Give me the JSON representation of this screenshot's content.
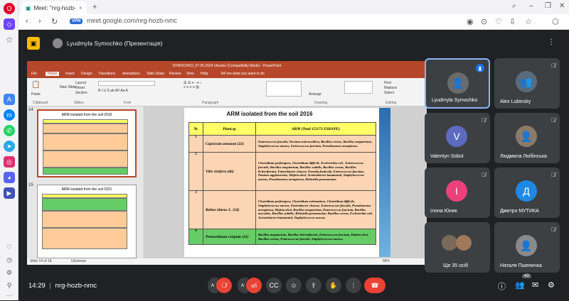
{
  "browser": {
    "tab_title": "Meet: \"nrg-hozb-",
    "url": "meet.google.com/nrg-hozb-nmc",
    "vpn_label": "VPN"
  },
  "presenter": {
    "label": "Lyudmyla Symochko (Презентація)"
  },
  "ppt": {
    "title": "SYMOCHKO_07.05.2024 Ukraine (Compatibility Mode) - PowerPoint",
    "tabs": [
      "File",
      "Home",
      "Insert",
      "Design",
      "Transitions",
      "Animations",
      "Slide Show",
      "Review",
      "View",
      "Help",
      "Tell me what you want to do"
    ],
    "ribbon": {
      "paste": "Paste",
      "new_slide": "New Slide",
      "layout": "Layout",
      "reset": "Reset",
      "section": "Section",
      "arrange": "Arrange",
      "find": "Find",
      "replace": "Replace",
      "select": "Select",
      "groups": [
        "Clipboard",
        "Slides",
        "Font",
        "Paragraph",
        "Drawing",
        "Editing"
      ]
    },
    "status": "Slide 14 of 18",
    "lang": "Ukrainian",
    "zoom": "68%",
    "thumb_numbers": [
      "14",
      "15"
    ],
    "thumb1_title": "ARM isolated from the soil 2016",
    "thumb2_title": "ARM isolated from the soil 2021"
  },
  "slide": {
    "title": "ARM  isolated from the soil 2016",
    "headers": [
      "№",
      "Plant,sp",
      "ARM (Total 153/73 ESKAPE)"
    ],
    "rows": [
      {
        "n": "1",
        "plant": "Capsicum annuum  (22)",
        "arm": "Enterococcus faecalis, Yersinia enterocolitica, Bacillus cereus, Bacillus megaterium, Staphylococcus aureus, Enterococcus faecium, Pseudomonas aeruginosa."
      },
      {
        "n": "2",
        "plant": "Vitis vinifera  (46)",
        "arm": "Clostridium perfringens, Clostridium difficile, Escherichia coli , Enterococcus faecalis, Bacillus megaterium, Bacillus subtilis, Bacillus cereus, Bacillus licheniformis, Enterobacter cloacae, Serratia fonticola, Enterococcus faecium, Pantoea agglomerans, Hafnia alvei, Acinetobacter baumannii, Staphylococcus aureus, Pseudomonas aeruginosa, Klebsiella pneumoniae."
      },
      {
        "n": "3",
        "plant": "Rubus idaeus L. (54)",
        "arm": "Clostridium perfringens, Clostridium sedematiens, Clostridium difficile, Staphylococcus aureus, Enterobacter cloacae, Enterococcus faecalis, Pseudomonas aeruginosa, Hafnia alvei, Bacillus megaterium, Enterococcus faecium, Bacillus mycoides, Bacillus subtilis, Klebsiella pneumoniae, Bacillus cereus, Escherichia coli, Acinetobacter baumannii, Staphylococcus aureus."
      },
      {
        "n": "4",
        "plant": "Petroselinum crispum (31)",
        "arm": "Bacillus megaterium, Bacillus licheniformis, Enterococcus faecium, Hafnia alvei, Bacillus cereus, Enterococcus faecalis, Staphylococcus aureus."
      }
    ]
  },
  "participants": [
    {
      "name": "Lyudmyla Symochko",
      "initial": "",
      "color": "#6b6b6b",
      "speaking": true
    },
    {
      "name": "Alex Lubinsky",
      "initial": "",
      "color": "#5a6b7a"
    },
    {
      "name": "Valentyn Sobol",
      "initial": "V",
      "color": "#5c6bc0"
    },
    {
      "name": "Людмила Любінська",
      "initial": "",
      "color": "#8a7a6a"
    },
    {
      "name": "Ілона Юник",
      "initial": "І",
      "color": "#ec407a"
    },
    {
      "name": "Дмитро МУТИКА",
      "initial": "Д",
      "color": "#1e88e5"
    },
    {
      "name": "Ще 35 осіб",
      "initial": "",
      "color": "#7a6a5a"
    },
    {
      "name": "Наталя Пшеничка",
      "initial": "",
      "color": "#8a8a8a"
    }
  ],
  "bottom": {
    "clock": "14:29",
    "meeting_code": "nrg-hozb-nmc",
    "participant_count": "43"
  }
}
